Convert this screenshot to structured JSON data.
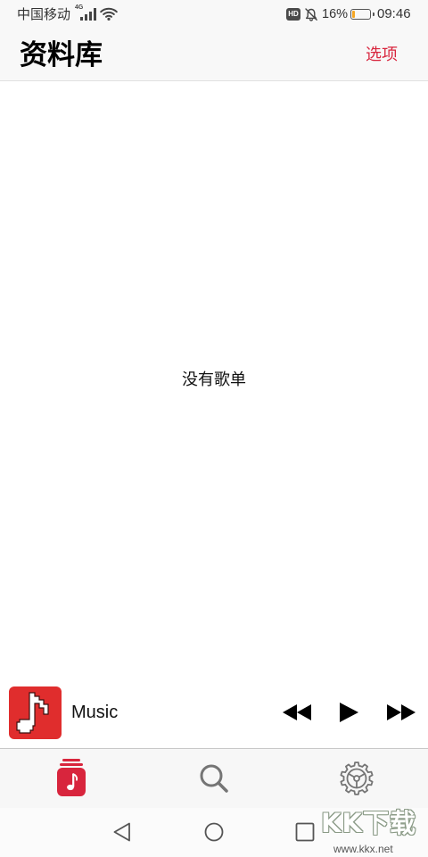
{
  "status_bar": {
    "carrier": "中国移动",
    "network": "4G",
    "hd_label": "HD",
    "battery_percent": "16%",
    "battery_level": 0.16,
    "time": "09:46",
    "signal_icon": "signal-icon",
    "wifi_icon": "wifi-icon",
    "mute_icon": "mute-bell-icon",
    "battery_icon": "battery-icon"
  },
  "header": {
    "title": "资料库",
    "options_label": "选项"
  },
  "library": {
    "empty_message": "没有歌单"
  },
  "mini_player": {
    "artwork_icon": "music-note-icon",
    "track_title": "Music",
    "controls": [
      "rewind-icon",
      "play-icon",
      "fast-forward-icon"
    ]
  },
  "tab_bar": {
    "tabs": [
      {
        "icon": "library-icon",
        "active": true
      },
      {
        "icon": "search-icon",
        "active": false
      },
      {
        "icon": "gear-icon",
        "active": false
      }
    ]
  },
  "system_nav": {
    "buttons": [
      "back-icon",
      "home-icon",
      "recents-icon"
    ]
  },
  "watermark": {
    "logo": "KK下载",
    "url": "www.kkx.net"
  },
  "colors": {
    "accent": "#d8253d",
    "artwork": "#e02d2d",
    "battery_low": "#f5a623",
    "inactive_icon": "#757575"
  }
}
